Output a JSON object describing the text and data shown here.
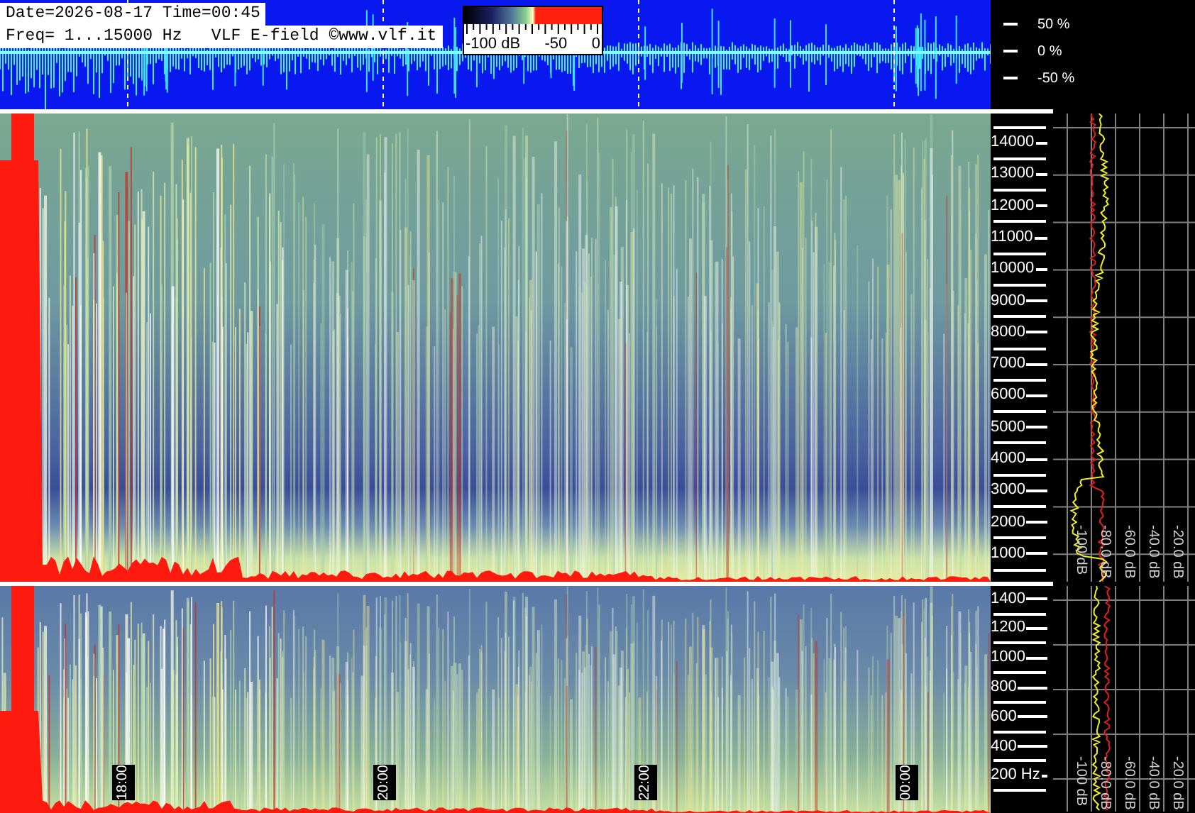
{
  "waveform_panel": {
    "info_lines": [
      "Date=2026-08-17 Time=00:45",
      "Freq= 1...15000 Hz   VLF E-field ©www.vlf.it"
    ],
    "colorbar": {
      "labels": [
        "-100 dB",
        "-50",
        "0"
      ]
    },
    "amplitude_ticks": [
      "50 %",
      "0 %",
      "-50 %"
    ]
  },
  "main_spectrogram": {
    "frequency_ticks": [
      "14000",
      "13000",
      "12000",
      "11000",
      "10000",
      "9000",
      "8000",
      "7000",
      "6000",
      "5000",
      "4000",
      "3000",
      "2000",
      "1000"
    ],
    "db_ticks": [
      "-100 dB",
      "-80.0 dB",
      "-60.0 dB",
      "-40.0 dB",
      "-20.0 dB"
    ]
  },
  "low_spectrogram": {
    "frequency_ticks": [
      "1400",
      "1200",
      "1000",
      "800",
      "600",
      "400",
      "200 Hz"
    ],
    "db_ticks": [
      "-100 dB",
      "-80.0 dB",
      "-60.0 dB",
      "-40.0 dB",
      "-20.0 dB"
    ],
    "time_labels": [
      "18:00",
      "20:00",
      "22:00",
      "00:00"
    ]
  }
}
